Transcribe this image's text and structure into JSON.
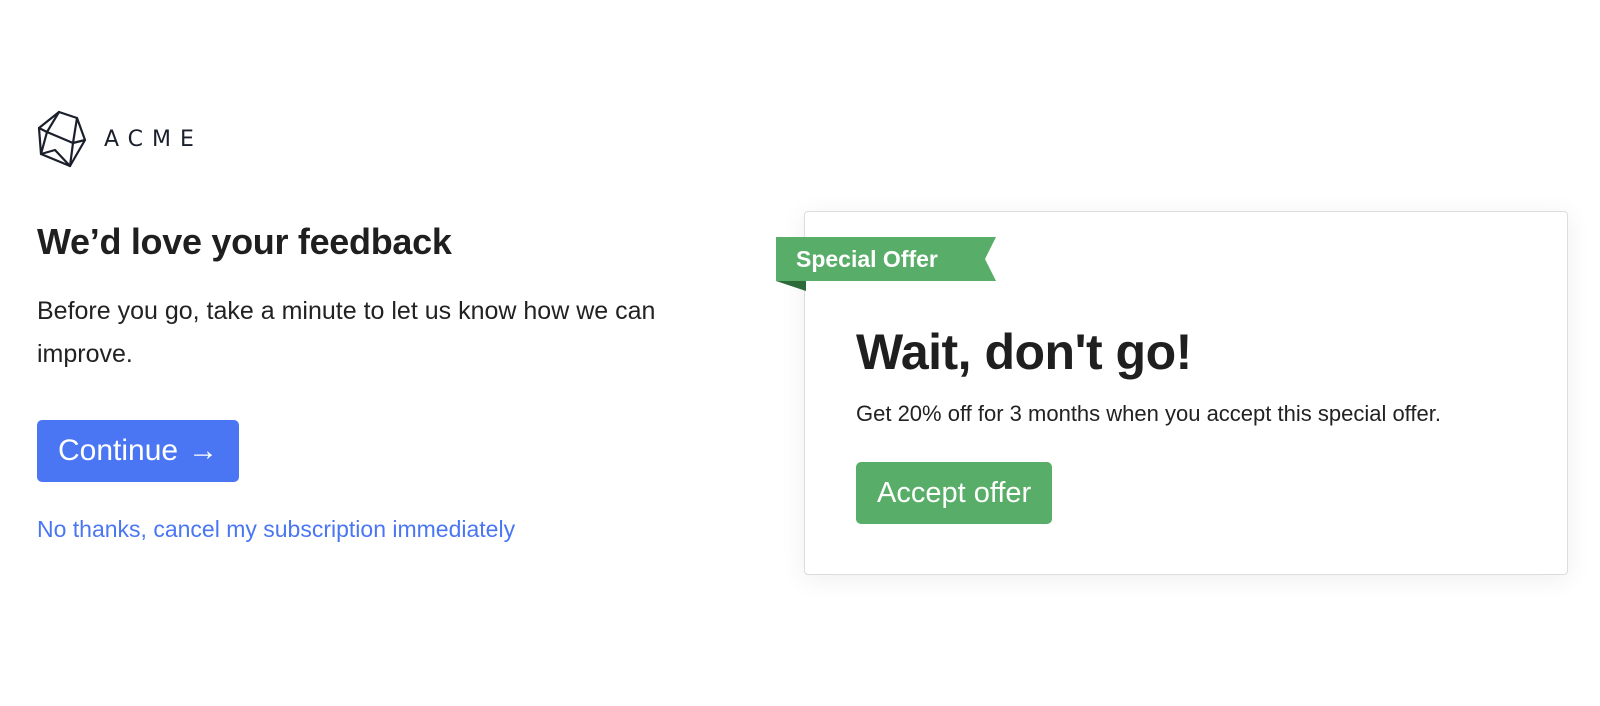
{
  "brand": {
    "name": "ACME",
    "logo_icon": "cube-logo-icon",
    "logo_color": "#1b1f2b"
  },
  "feedback": {
    "heading": "We’d love your feedback",
    "subtext": "Before you go, take a minute to let us know how we can improve.",
    "continue_label": "Continue",
    "continue_arrow": "→",
    "cancel_link": "No thanks, cancel my subscription immediately"
  },
  "offer": {
    "ribbon_label": "Special Offer",
    "title": "Wait, don't go!",
    "description": "Get 20% off for 3 months when you accept this special offer.",
    "accept_label": "Accept offer"
  },
  "colors": {
    "primary": "#4a76f4",
    "offer_green": "#58ae68",
    "ribbon_fold": "#2d6a3a"
  }
}
